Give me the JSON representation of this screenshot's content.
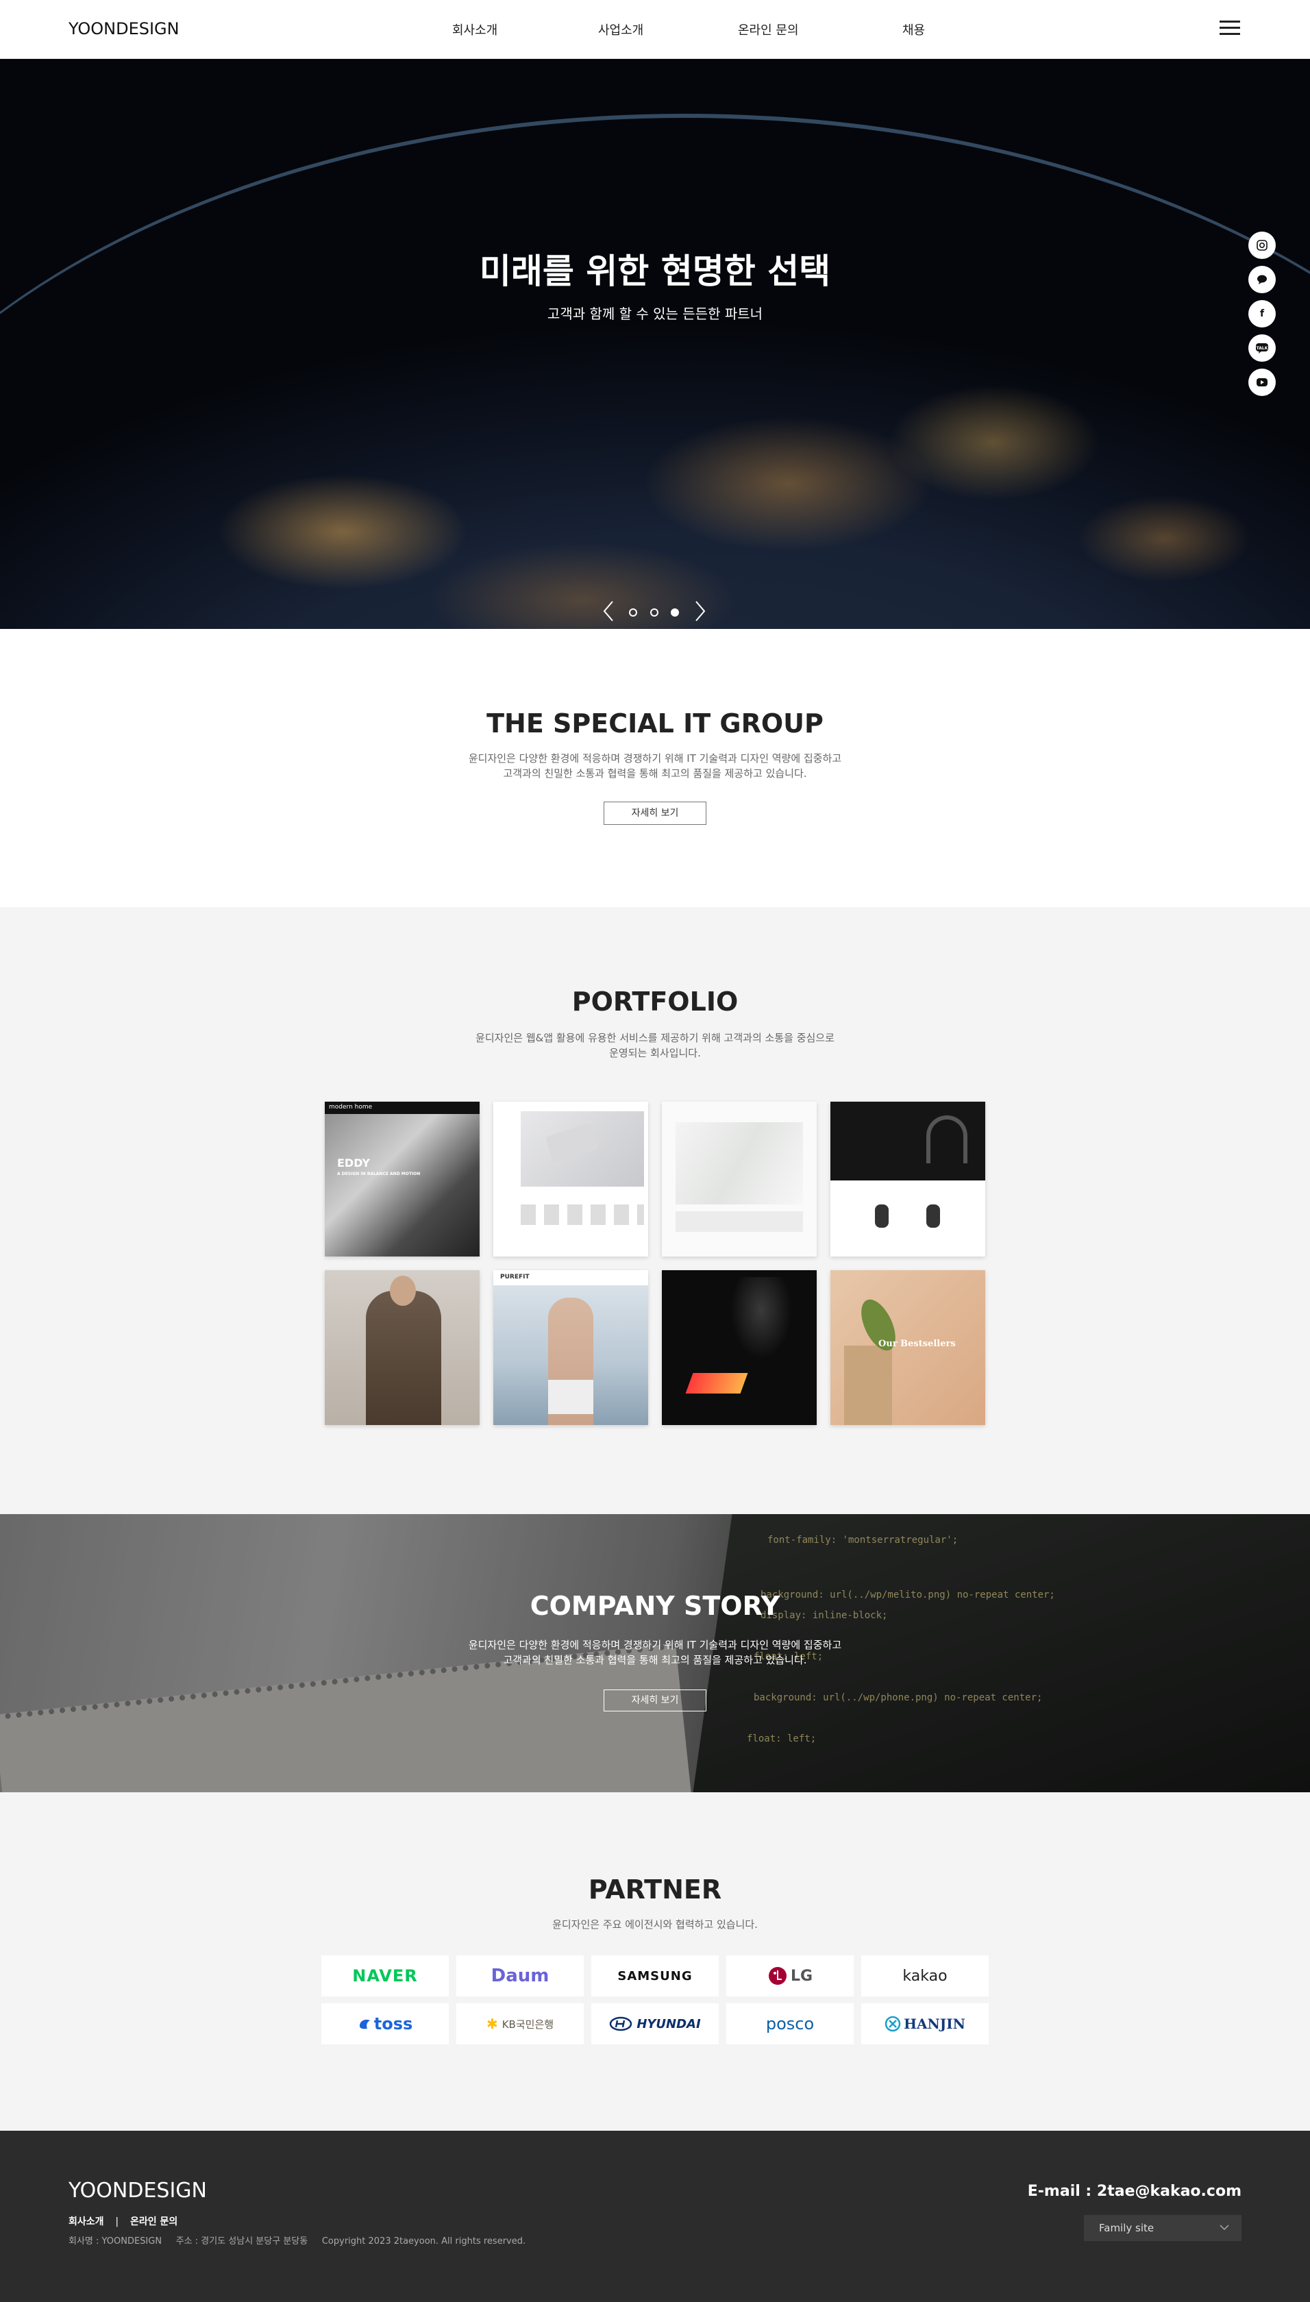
{
  "header": {
    "logo": "YOONDESIGN",
    "nav": [
      "회사소개",
      "사업소개",
      "온라인 문의",
      "채용"
    ]
  },
  "hero": {
    "title": "미래를 위한 현명한 선택",
    "subtitle": "고객과 함께 할 수 있는 든든한 파트너",
    "social_icons": [
      "instagram-icon",
      "chat-bubble-icon",
      "facebook-icon",
      "talk-icon",
      "youtube-icon"
    ],
    "slide_count": 3,
    "active_slide": 3
  },
  "special": {
    "title": "THE SPECIAL IT GROUP",
    "desc_line1": "윤디자인은 다양한 환경에 적응하며 경쟁하기 위해 IT 기술력과 디자인 역량에 집중하고",
    "desc_line2": "고객과의 친밀한 소통과 협력을 통해 최고의 품질을 제공하고 있습니다.",
    "button": "자세히 보기"
  },
  "portfolio": {
    "title": "PORTFOLIO",
    "desc_line1": "윤디자인은 웹&앱 활용에 유용한 서비스를 제공하기 위해 고객과의 소통을 중심으로",
    "desc_line2": "운영되는 회사입니다.",
    "items": [
      {
        "label": "EDDY",
        "sub": "A DESIGN IN BALANCE AND MOTION",
        "header": "modern home"
      },
      {
        "label": "",
        "sub": "",
        "header": ""
      },
      {
        "label": "",
        "sub": "",
        "header": ""
      },
      {
        "label": "",
        "sub": "",
        "header": ""
      },
      {
        "label": "",
        "sub": "",
        "header": ""
      },
      {
        "label": "",
        "sub": "",
        "header": "PUREFIT"
      },
      {
        "label": "",
        "sub": "",
        "header": ""
      },
      {
        "label": "Our Bestsellers",
        "sub": "",
        "header": ""
      }
    ]
  },
  "story": {
    "title": "COMPANY STORY",
    "desc_line1": "윤디자인은 다양한 환경에 적응하며 경쟁하기 위해 IT 기술력과 디자인 역량에 집중하고",
    "desc_line2": "고객과의 친밀한 소통과 협력을 통해 최고의 품질을 제공하고 있습니다.",
    "button": "자세히 보기"
  },
  "partner": {
    "title": "PARTNER",
    "desc": "윤디자인은 주요 에이전시와 협력하고 있습니다.",
    "logos": [
      "NAVER",
      "Daum",
      "SAMSUNG",
      "LG",
      "kakao",
      "toss",
      "KB국민은행",
      "HYUNDAI",
      "posco",
      "HANJIN"
    ]
  },
  "footer": {
    "logo": "YOONDESIGN",
    "link1": "회사소개",
    "sep": "|",
    "link2": "온라인 문의",
    "info": "회사명 : YOONDESIGN     주소 : 경기도 성남시 분당구 분당동     Copyright 2023 2taeyoon. All rights reserved.",
    "email": "E-mail : 2tae@kakao.com",
    "family_site": "Family site"
  },
  "colors": {
    "naver": "#03c75a",
    "footer_bg": "#2c2c2c",
    "section_bg": "#f4f4f4"
  }
}
